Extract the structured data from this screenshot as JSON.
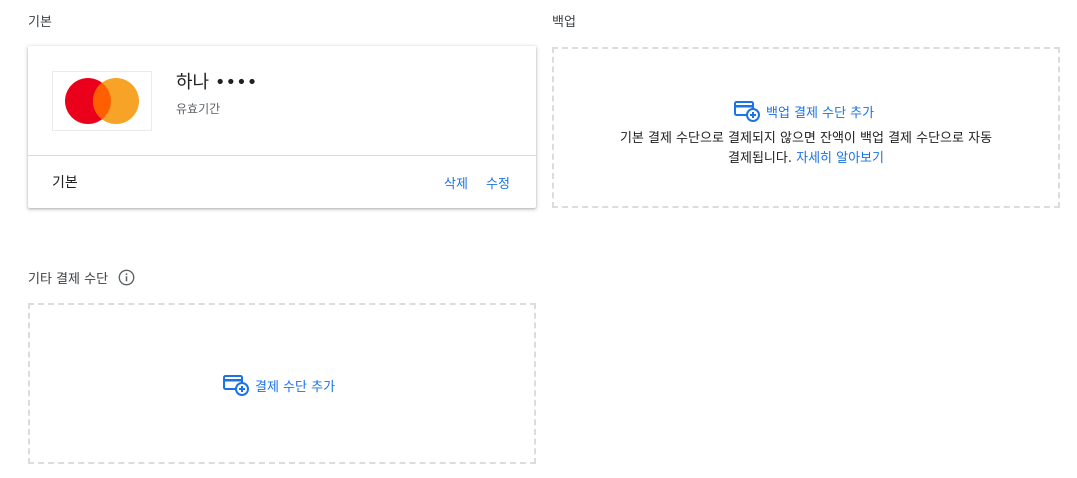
{
  "sections": {
    "primary_label": "기본",
    "backup_label": "백업",
    "other_label": "기타 결제 수단"
  },
  "primary_card": {
    "name": "하나 ••••",
    "expiry_label": "유효기간",
    "footer_label": "기본",
    "delete_label": "삭제",
    "edit_label": "수정",
    "brand_icon": "mastercard-logo"
  },
  "backup": {
    "add_label": "백업 결제 수단 추가",
    "description_line1": "기본 결제 수단으로 결제되지 않으면 잔액이 백업 결제 수단으로 자동",
    "description_line2_prefix": "결제됩니다. ",
    "learn_more": "자세히 알아보기"
  },
  "other": {
    "add_label": "결제 수단 추가",
    "info_icon": "info-icon"
  },
  "colors": {
    "link": "#1a73e8",
    "dashed_border": "#dadce0",
    "mastercard_red": "#eb001b",
    "mastercard_orange": "#f79e1b"
  }
}
